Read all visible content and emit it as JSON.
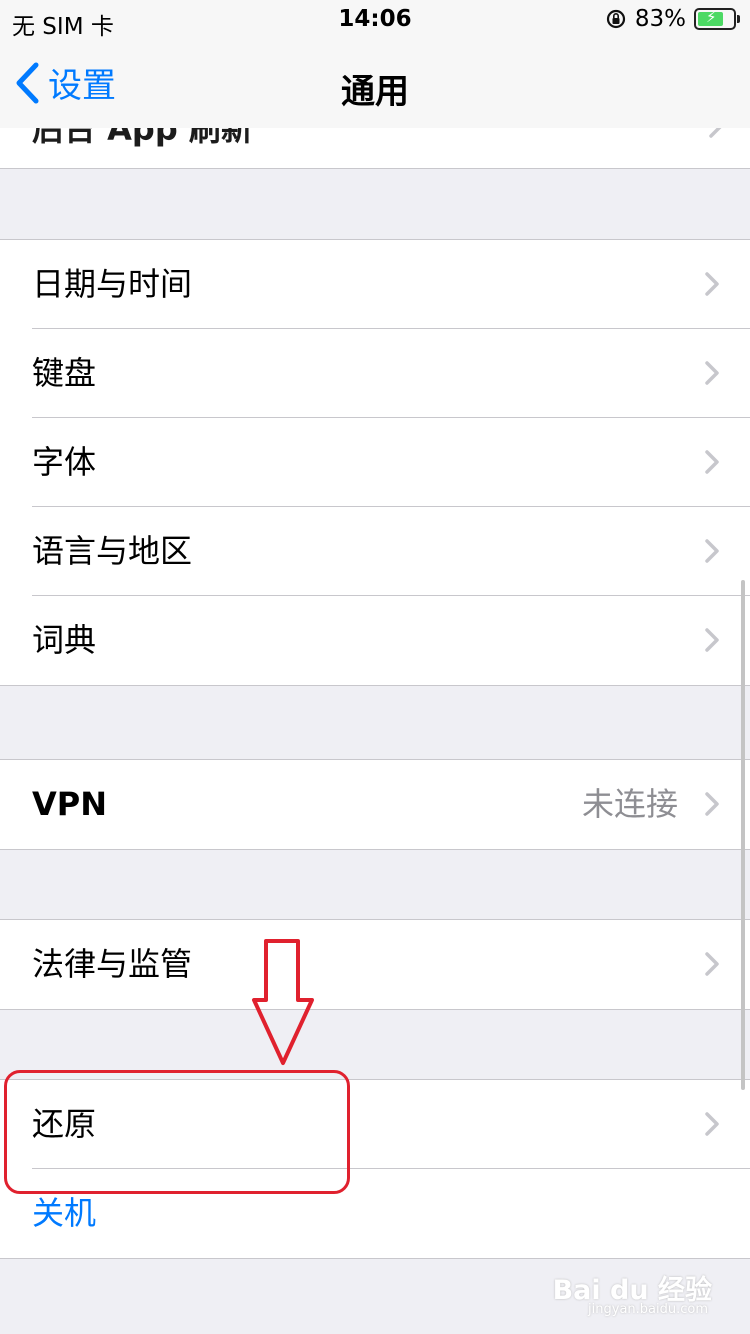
{
  "status": {
    "carrier": "无 SIM 卡",
    "time": "14:06",
    "battery": "83%",
    "battery_level": 0.83
  },
  "nav": {
    "back_label": "设置",
    "title": "通用"
  },
  "cut_row": {
    "label": "后台 App 刷新"
  },
  "groups": {
    "g1": {
      "rows": [
        {
          "label": "日期与时间"
        },
        {
          "label": "键盘"
        },
        {
          "label": "字体"
        },
        {
          "label": "语言与地区"
        },
        {
          "label": "词典"
        }
      ]
    },
    "g2": {
      "rows": [
        {
          "label": "VPN",
          "value": "未连接"
        }
      ]
    },
    "g3": {
      "rows": [
        {
          "label": "法律与监管"
        }
      ]
    },
    "g4": {
      "rows": [
        {
          "label": "还原"
        },
        {
          "label": "关机"
        }
      ]
    }
  },
  "colors": {
    "accent": "#007aff",
    "annotation": "#e0212e"
  },
  "watermark": {
    "main": "Bai du 经验",
    "sub": "jingyan.baidu.com"
  }
}
